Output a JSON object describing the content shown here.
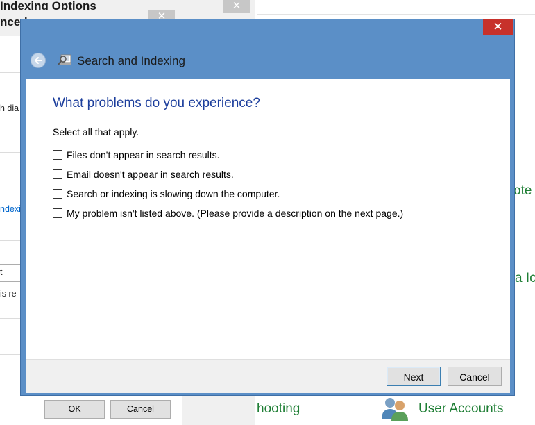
{
  "background_panel": {
    "fragments": {
      "ote": "ote",
      "ic": "a Ic",
      "shooting": "hooting",
      "user_accounts": "User Accounts"
    }
  },
  "indexing_window": {
    "title": "Indexing Options",
    "advanced_title": "nced",
    "close": "✕",
    "fragments": {
      "h_dia": "h dia",
      "indexi": "ndexi",
      "t": "t",
      "is_re": "is re"
    },
    "ok_label": "OK",
    "cancel_label": "Cancel"
  },
  "dialog": {
    "title": "Search and Indexing",
    "close": "✕",
    "heading": "What problems do you experience?",
    "instruction": "Select all that apply.",
    "options": [
      {
        "label": "Files don't appear in search results.",
        "checked": false
      },
      {
        "label": "Email doesn't appear in search results.",
        "checked": false
      },
      {
        "label": "Search or indexing is slowing down the computer.",
        "checked": false
      },
      {
        "label": "My problem isn't listed above. (Please provide a description on the next page.)",
        "checked": false
      }
    ],
    "next_label": "Next",
    "cancel_label": "Cancel"
  },
  "colors": {
    "dialog_frame": "#5b8fc7",
    "close_button": "#c7312b",
    "heading": "#1c3e9c",
    "control_panel_link": "#1e7e34"
  },
  "icons": {
    "back": "back-arrow-icon",
    "title": "search-indexing-icon",
    "close": "close-icon",
    "users": "user-accounts-icon"
  }
}
